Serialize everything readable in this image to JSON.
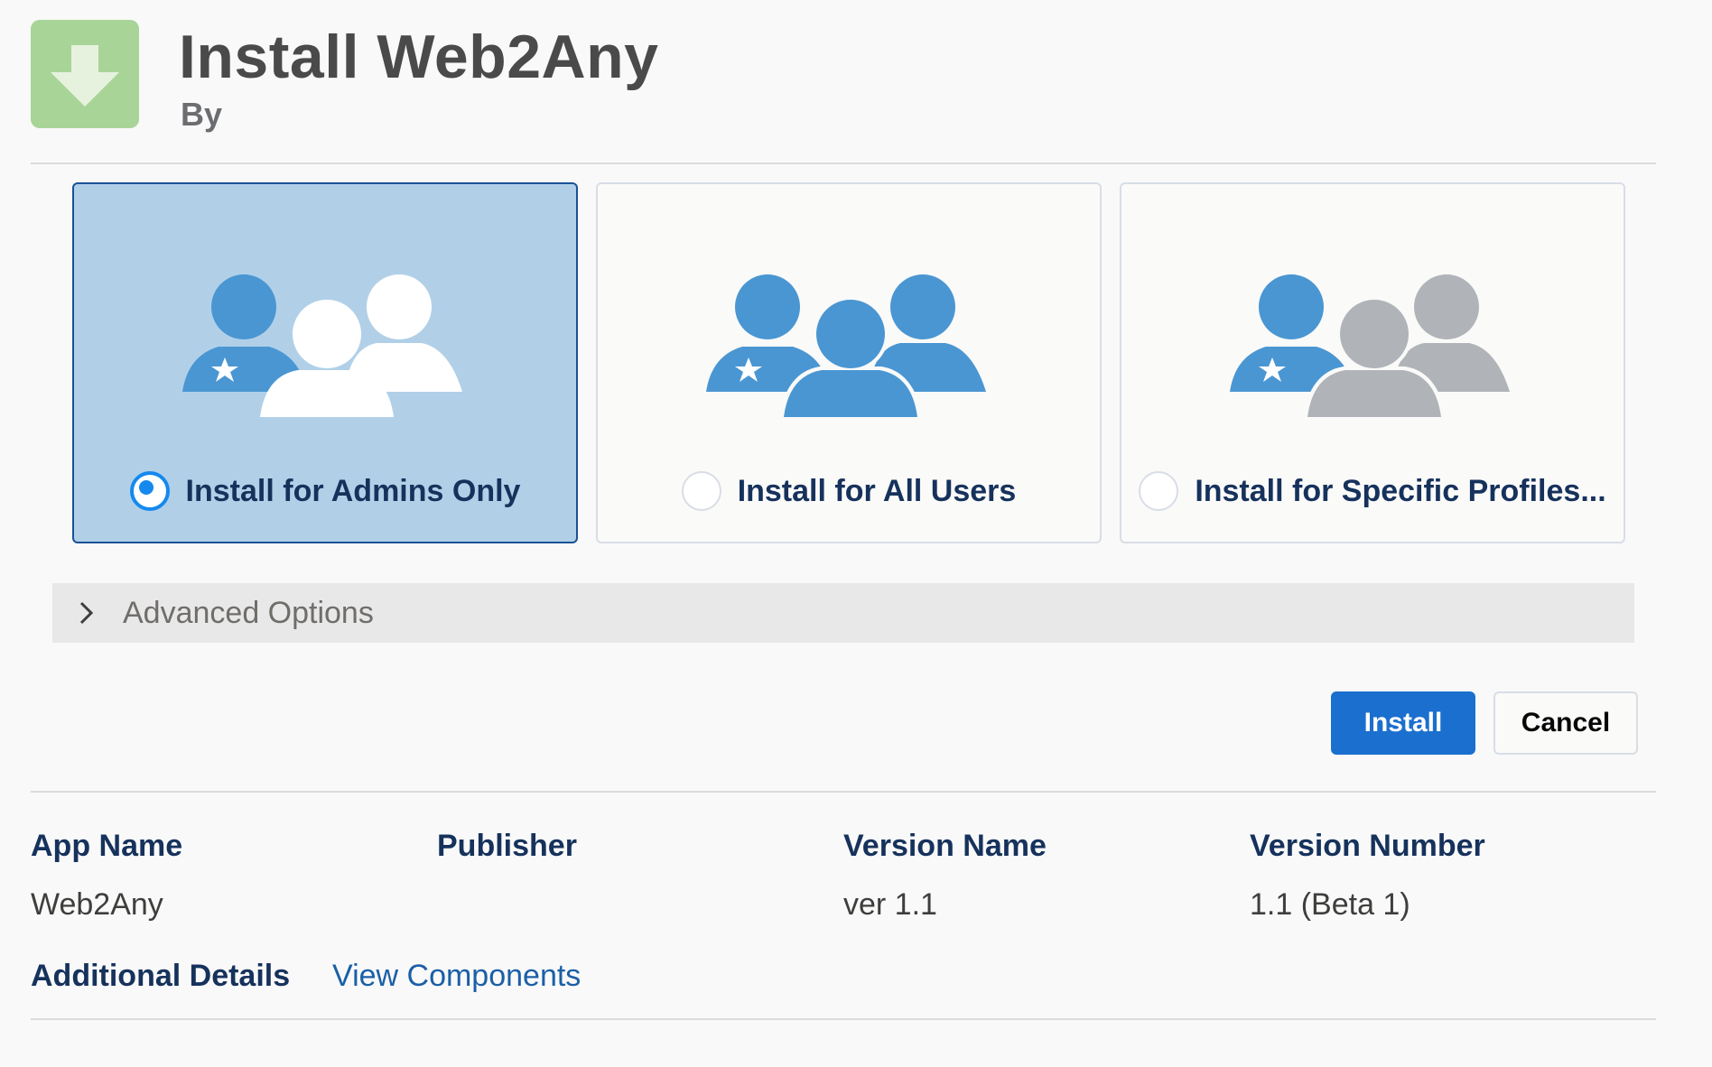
{
  "header": {
    "title": "Install Web2Any",
    "byline": "By",
    "icon": "download-arrow-icon"
  },
  "options": [
    {
      "label": "Install for Admins Only",
      "selected": true,
      "icon": "admin-users-icon"
    },
    {
      "label": "Install for All Users",
      "selected": false,
      "icon": "all-users-icon"
    },
    {
      "label": "Install for Specific Profiles...",
      "selected": false,
      "icon": "specific-profiles-icon"
    }
  ],
  "advanced": {
    "label": "Advanced Options",
    "icon": "chevron-right-icon"
  },
  "buttons": {
    "install": "Install",
    "cancel": "Cancel"
  },
  "details": {
    "app_name_label": "App Name",
    "app_name": "Web2Any",
    "publisher_label": "Publisher",
    "publisher": "",
    "version_name_label": "Version Name",
    "version_name": "ver 1.1",
    "version_number_label": "Version Number",
    "version_number": "1.1 (Beta 1)",
    "additional_details_label": "Additional Details",
    "view_components_link": "View Components"
  },
  "colors": {
    "accent": "#1b6fce",
    "selected_card": "#b1d0e8",
    "user_blue": "#4a96d2",
    "user_gray": "#b0b4b8",
    "app_icon_green": "#a8d597"
  }
}
